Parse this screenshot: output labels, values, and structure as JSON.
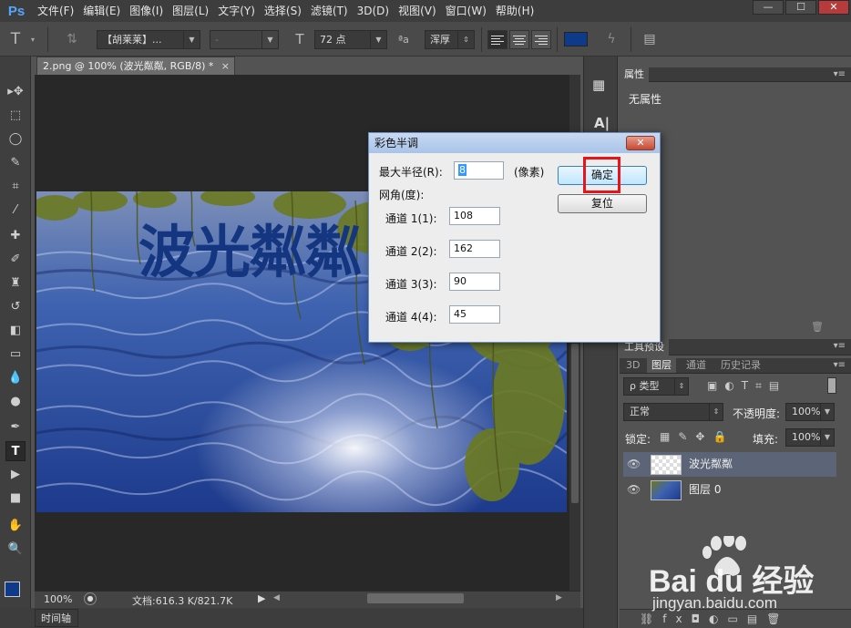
{
  "app": {
    "logo": "Ps"
  },
  "menu": [
    "文件(F)",
    "编辑(E)",
    "图像(I)",
    "图层(L)",
    "文字(Y)",
    "选择(S)",
    "滤镜(T)",
    "3D(D)",
    "视图(V)",
    "窗口(W)",
    "帮助(H)"
  ],
  "window_controls": {
    "minimize": "—",
    "maximize": "☐",
    "close": "✕"
  },
  "options": {
    "tool_glyph": "T",
    "font_family": "【胡莱莱】...",
    "font_style": "-",
    "font_size": "72 点",
    "aa_label": "ªa",
    "antialias": "浑厚",
    "text_color": "#0f3a8a"
  },
  "document": {
    "tab_title": "2.png @ 100% (波光粼粼, RGB/8) *",
    "tab_close": "×",
    "canvas_text": "波光粼粼",
    "zoom": "100%",
    "doc_size": "文档:616.3 K/821.7K",
    "timeline_tab": "时间轴"
  },
  "properties_panel": {
    "tab": "属性",
    "content": "无属性"
  },
  "tool_presets_panel": {
    "tab": "工具预设"
  },
  "layers_panel": {
    "tabs": [
      "3D",
      "图层",
      "通道",
      "历史记录"
    ],
    "active_tab": "图层",
    "filter_kind": "ρ 类型",
    "blend_mode": "正常",
    "opacity_label": "不透明度:",
    "opacity_value": "100%",
    "lock_label": "锁定:",
    "fill_label": "填充:",
    "fill_value": "100%",
    "layers": [
      {
        "name": "波光粼粼",
        "selected": true
      },
      {
        "name": "图层 0",
        "selected": false
      }
    ]
  },
  "dialog": {
    "title": "彩色半调",
    "close": "✕",
    "max_radius_label": "最大半径(R):",
    "max_radius_value": "8",
    "pixels_unit": "(像素)",
    "screen_angles_label": "网角(度):",
    "channels": [
      {
        "label": "通道 1(1):",
        "value": "108"
      },
      {
        "label": "通道 2(2):",
        "value": "162"
      },
      {
        "label": "通道 3(3):",
        "value": "90"
      },
      {
        "label": "通道 4(4):",
        "value": "45"
      }
    ],
    "ok_label": "确定",
    "reset_label": "复位"
  },
  "watermark": {
    "brand": "Bai du 经验",
    "url": "jingyan.baidu.com"
  }
}
